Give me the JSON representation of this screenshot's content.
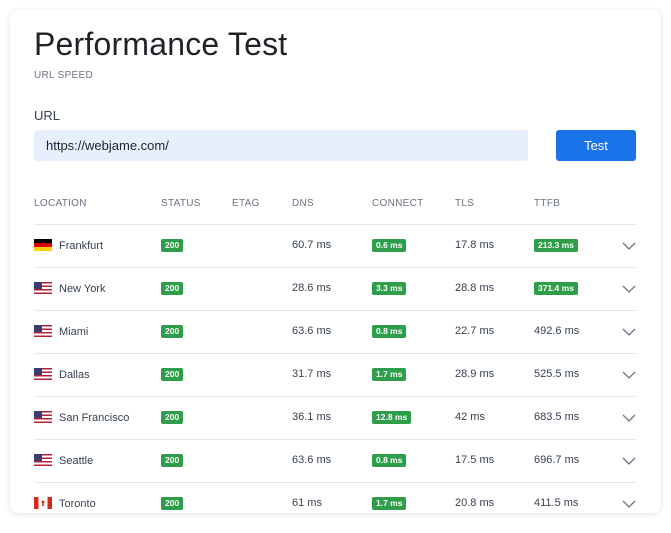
{
  "header": {
    "title": "Performance Test",
    "subtitle": "URL SPEED"
  },
  "form": {
    "url_label": "URL",
    "url_value": "https://webjame.com/",
    "test_button": "Test"
  },
  "table": {
    "columns": [
      "LOCATION",
      "STATUS",
      "ETAG",
      "DNS",
      "CONNECT",
      "TLS",
      "TTFB"
    ],
    "rows": [
      {
        "location": "Frankfurt",
        "flag": "flag-de",
        "status": "200",
        "etag": "",
        "dns": "60.7 ms",
        "connect": "0.6 ms",
        "tls": "17.8 ms",
        "ttfb": "213.3 ms",
        "ttfb_badge": true
      },
      {
        "location": "New York",
        "flag": "flag-us",
        "status": "200",
        "etag": "",
        "dns": "28.6 ms",
        "connect": "3.3 ms",
        "tls": "28.8 ms",
        "ttfb": "371.4 ms",
        "ttfb_badge": true
      },
      {
        "location": "Miami",
        "flag": "flag-us",
        "status": "200",
        "etag": "",
        "dns": "63.6 ms",
        "connect": "0.8 ms",
        "tls": "22.7 ms",
        "ttfb": "492.6 ms",
        "ttfb_badge": false
      },
      {
        "location": "Dallas",
        "flag": "flag-us",
        "status": "200",
        "etag": "",
        "dns": "31.7 ms",
        "connect": "1.7 ms",
        "tls": "28.9 ms",
        "ttfb": "525.5 ms",
        "ttfb_badge": false
      },
      {
        "location": "San Francisco",
        "flag": "flag-us",
        "status": "200",
        "etag": "",
        "dns": "36.1 ms",
        "connect": "12.8 ms",
        "tls": "42 ms",
        "ttfb": "683.5 ms",
        "ttfb_badge": false
      },
      {
        "location": "Seattle",
        "flag": "flag-us",
        "status": "200",
        "etag": "",
        "dns": "63.6 ms",
        "connect": "0.8 ms",
        "tls": "17.5 ms",
        "ttfb": "696.7 ms",
        "ttfb_badge": false
      },
      {
        "location": "Toronto",
        "flag": "flag-ca",
        "status": "200",
        "etag": "",
        "dns": "61 ms",
        "connect": "1.7 ms",
        "tls": "20.8 ms",
        "ttfb": "411.5 ms",
        "ttfb_badge": false
      }
    ]
  },
  "colors": {
    "accent": "#1a73e8",
    "badge_green": "#2e9e4a",
    "input_bg": "#e8effc"
  },
  "icons": {
    "expand": "chevron-down-icon"
  }
}
